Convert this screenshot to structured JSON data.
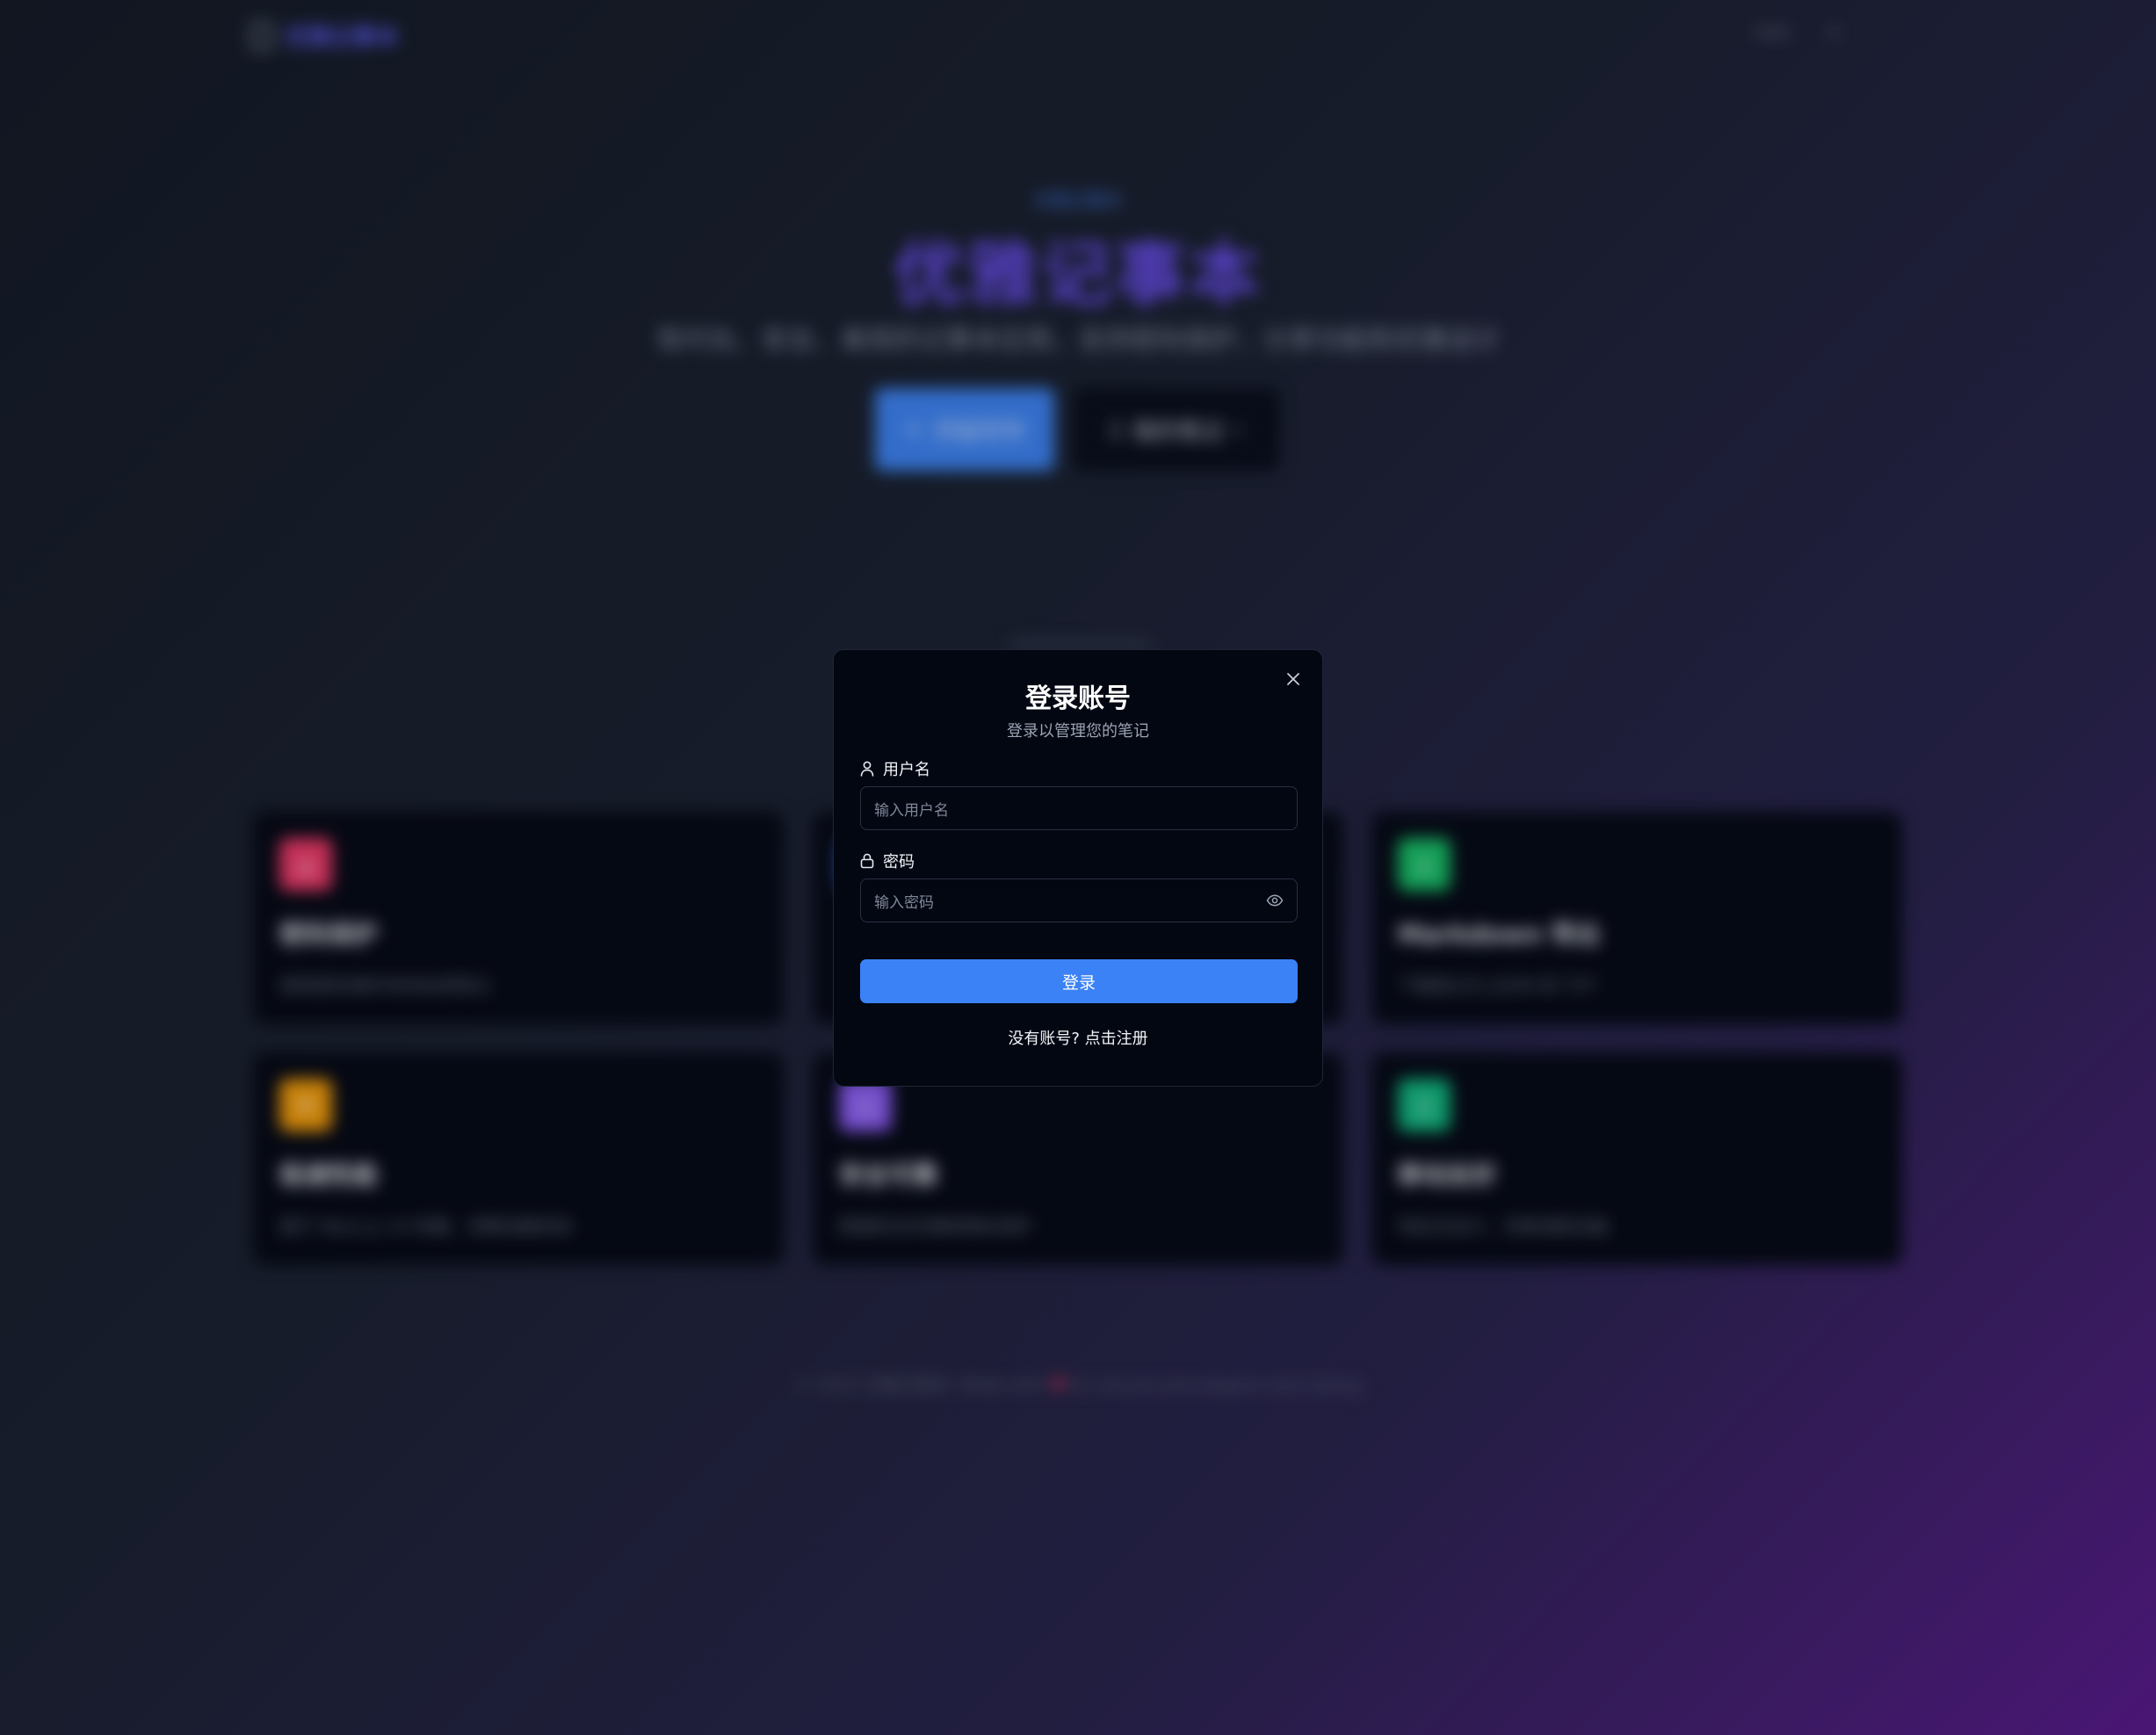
{
  "background": {
    "nav": {
      "logo_text": "优雅记事本",
      "right_item_1": "•••",
      "right_item_2": "•"
    },
    "hero": {
      "badge": "优雅记事本",
      "title": "优雅记事本",
      "subtitle": "现代化、安全、美观的记事本应用，支持密码保护、分享功能和优雅设计",
      "primary_button": "开始写作",
      "secondary_button": "我的笔记"
    },
    "cards": [
      {
        "title": "密码保护",
        "desc": "使用密码保护你的私密笔记",
        "color": "#f03a6b"
      },
      {
        "title": "",
        "desc": "",
        "color": "#3b82f6"
      },
      {
        "title": "Markdown 导出",
        "desc": "下载笔记为 JSON 和 TXT",
        "color": "#18c26a"
      },
      {
        "title": "极速性能",
        "desc": "基于 Next.js 14 构建，流畅加载体验",
        "color": "#f59e0b"
      },
      {
        "title": "安全可靠",
        "desc": "数据安全存储和隐私保护",
        "color": "#8b5cf6"
      },
      {
        "title": "移动友好",
        "desc": "响应式设计，完美适配设备",
        "color": "#10b981"
      }
    ],
    "footer": {
      "text_before": "© 2025 优雅记事本. Made with",
      "heart": "♥",
      "text_after": "for secure and elegant note taking"
    }
  },
  "modal": {
    "title": "登录账号",
    "subtitle": "登录以管理您的笔记",
    "username": {
      "label": "用户名",
      "placeholder": "输入用户名",
      "value": ""
    },
    "password": {
      "label": "密码",
      "placeholder": "输入密码",
      "value": ""
    },
    "submit_label": "登录",
    "register_link": "没有账号? 点击注册"
  },
  "colors": {
    "accent": "#3b82f6",
    "modal_bg": "#030712",
    "input_border": "#283041"
  },
  "icons": {
    "close": "close-icon",
    "user": "user-icon",
    "lock": "lock-icon",
    "eye": "eye-icon"
  }
}
